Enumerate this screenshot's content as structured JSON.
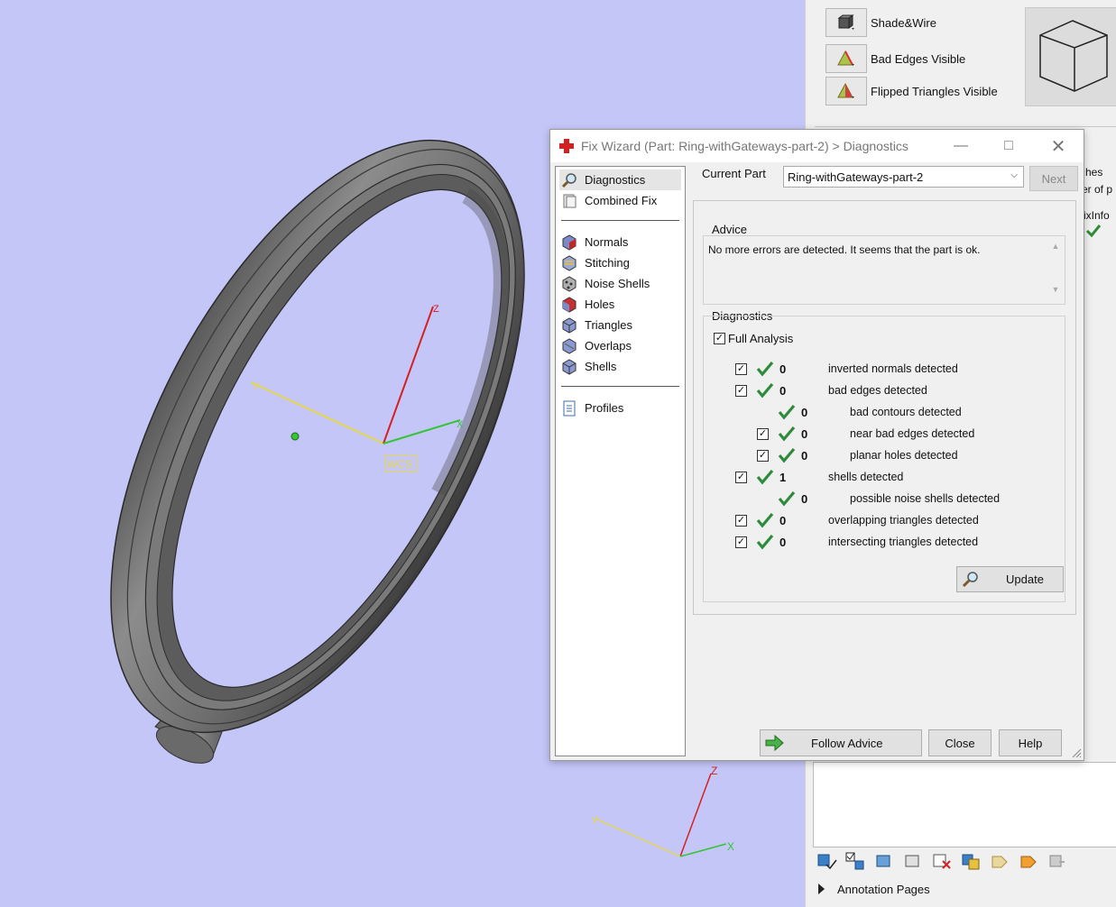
{
  "viewport": {
    "wcs_label": "WCS",
    "axis_z": "Z",
    "axis_y": "Y",
    "axis_x": "X"
  },
  "right_panel": {
    "view_modes": [
      {
        "label": "Shade&Wire",
        "icon": "shade-wire-icon"
      },
      {
        "label": "Bad Edges Visible",
        "icon": "bad-edges-icon"
      },
      {
        "label": "Flipped Triangles Visible",
        "icon": "flipped-triangles-icon"
      }
    ],
    "partial_text_1": "hes",
    "partial_text_2": "er of p",
    "partial_text_3": "ixInfo",
    "annotation_pages": "Annotation Pages"
  },
  "dialog": {
    "title": "Fix Wizard (Part: Ring-withGateways-part-2) > Diagnostics",
    "nav_group_1": [
      {
        "label": "Diagnostics",
        "icon": "magnifier-icon",
        "selected": true
      },
      {
        "label": "Combined Fix",
        "icon": "combined-fix-icon",
        "selected": false
      }
    ],
    "nav_group_2": [
      {
        "label": "Normals",
        "icon": "normals-icon"
      },
      {
        "label": "Stitching",
        "icon": "stitching-icon"
      },
      {
        "label": "Noise Shells",
        "icon": "noise-shells-icon"
      },
      {
        "label": "Holes",
        "icon": "holes-icon"
      },
      {
        "label": "Triangles",
        "icon": "triangles-icon"
      },
      {
        "label": "Overlaps",
        "icon": "overlaps-icon"
      },
      {
        "label": "Shells",
        "icon": "shells-icon"
      }
    ],
    "nav_group_3": [
      {
        "label": "Profiles",
        "icon": "profiles-icon"
      }
    ],
    "current_part_label": "Current Part",
    "current_part_value": "Ring-withGateways-part-2",
    "next_label": "Next",
    "advice_title": "Advice",
    "advice_text": "No more errors are detected. It seems that the part is ok.",
    "diagnostics_title": "Diagnostics",
    "full_analysis_label": "Full Analysis",
    "full_analysis_checked": true,
    "rows": [
      {
        "count": "0",
        "desc": "inverted normals detected",
        "level": 0,
        "checkbox": true
      },
      {
        "count": "0",
        "desc": "bad edges detected",
        "level": 0,
        "checkbox": true
      },
      {
        "count": "0",
        "desc": "bad contours detected",
        "level": 1,
        "checkbox": false
      },
      {
        "count": "0",
        "desc": "near bad edges detected",
        "level": 1,
        "checkbox": true
      },
      {
        "count": "0",
        "desc": "planar holes detected",
        "level": 1,
        "checkbox": true
      },
      {
        "count": "1",
        "desc": "shells detected",
        "level": 0,
        "checkbox": true
      },
      {
        "count": "0",
        "desc": "possible noise shells detected",
        "level": 1,
        "checkbox": false
      },
      {
        "count": "0",
        "desc": "overlapping triangles detected",
        "level": 0,
        "checkbox": true
      },
      {
        "count": "0",
        "desc": "intersecting triangles detected",
        "level": 0,
        "checkbox": true
      }
    ],
    "update_label": "Update",
    "follow_advice_label": "Follow Advice",
    "close_label": "Close",
    "help_label": "Help"
  },
  "colors": {
    "viewport_bg": "#c5c6f8",
    "check_green": "#2e8b3a",
    "axis_yellow": "#e6d84a",
    "axis_red": "#d42020",
    "axis_green": "#34c434"
  }
}
